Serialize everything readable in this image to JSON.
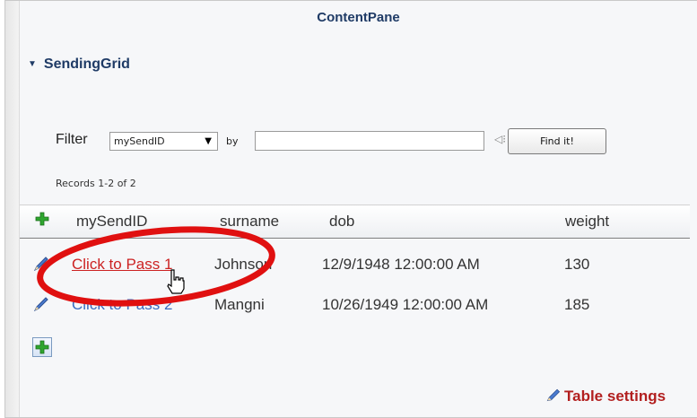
{
  "pane": {
    "title": "ContentPane"
  },
  "section": {
    "title": "SendingGrid",
    "toggle_icon": "triangle-down-icon"
  },
  "filter": {
    "label": "Filter",
    "field_selected": "mySendID",
    "by_label": "by",
    "search_value": "",
    "find_button_label": "Find it!"
  },
  "records_text": "Records 1-2 of 2",
  "grid": {
    "columns": [
      "mySendID",
      "surname",
      "dob",
      "weight"
    ],
    "rows": [
      {
        "mySendID": "Click to Pass 1",
        "surname": "Johnson",
        "dob": "12/9/1948 12:00:00 AM",
        "weight": "130"
      },
      {
        "mySendID": "Click to Pass 2",
        "surname": "Mangni",
        "dob": "10/26/1949 12:00:00 AM",
        "weight": "185"
      }
    ]
  },
  "footer": {
    "table_settings_label": "Table settings"
  },
  "colors": {
    "accent": "#1f3b66",
    "link": "#3a6bc0",
    "link_hover": "#cc2222",
    "highlight_ellipse": "#e01010",
    "add_green": "#2fa62f"
  }
}
